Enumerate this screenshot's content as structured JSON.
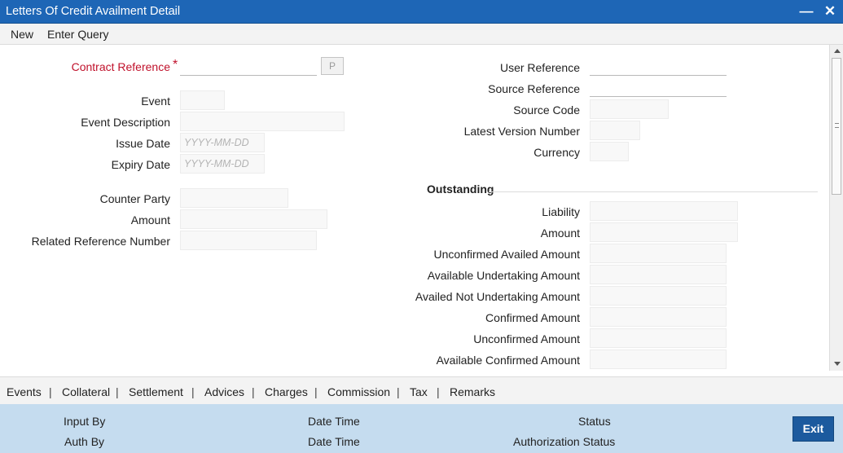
{
  "window": {
    "title": "Letters Of Credit Availment Detail",
    "minimize_glyph": "—",
    "close_glyph": "✕"
  },
  "menu": {
    "new": "New",
    "enter_query": "Enter Query"
  },
  "left": {
    "contract_reference": {
      "label": "Contract Reference",
      "required_mark": "*",
      "value": "",
      "pick_button": "P"
    },
    "event": {
      "label": "Event",
      "value": ""
    },
    "event_description": {
      "label": "Event Description",
      "value": ""
    },
    "issue_date": {
      "label": "Issue Date",
      "value": "",
      "placeholder": "YYYY-MM-DD"
    },
    "expiry_date": {
      "label": "Expiry Date",
      "value": "",
      "placeholder": "YYYY-MM-DD"
    },
    "counter_party": {
      "label": "Counter Party",
      "value": ""
    },
    "amount": {
      "label": "Amount",
      "value": ""
    },
    "related_reference_number": {
      "label": "Related Reference Number",
      "value": ""
    }
  },
  "right": {
    "user_reference": {
      "label": "User Reference",
      "value": ""
    },
    "source_reference": {
      "label": "Source Reference",
      "value": ""
    },
    "source_code": {
      "label": "Source Code",
      "value": ""
    },
    "latest_version_number": {
      "label": "Latest Version Number",
      "value": ""
    },
    "currency": {
      "label": "Currency",
      "value": ""
    }
  },
  "outstanding": {
    "title": "Outstanding",
    "liability": {
      "label": "Liability",
      "value": ""
    },
    "amount": {
      "label": "Amount",
      "value": ""
    },
    "unconfirmed_availed_amount": {
      "label": "Unconfirmed Availed Amount",
      "value": ""
    },
    "available_undertaking_amount": {
      "label": "Available Undertaking Amount",
      "value": ""
    },
    "availed_not_undertaking_amount": {
      "label": "Availed Not Undertaking Amount",
      "value": ""
    },
    "confirmed_amount": {
      "label": "Confirmed Amount",
      "value": ""
    },
    "unconfirmed_amount": {
      "label": "Unconfirmed Amount",
      "value": ""
    },
    "available_confirmed_amount": {
      "label": "Available Confirmed Amount",
      "value": ""
    }
  },
  "tabs": [
    "Events",
    "Collateral",
    "Settlement",
    "Advices",
    "Charges",
    "Commission",
    "Tax",
    "Remarks"
  ],
  "tab_separator": "|",
  "footer": {
    "input_by": "Input By",
    "date_time_1": "Date Time",
    "status": "Status",
    "auth_by": "Auth By",
    "date_time_2": "Date Time",
    "authorization_status": "Authorization Status",
    "exit_label": "Exit"
  },
  "colors": {
    "title_bar": "#1e66b6",
    "required": "#c0112b",
    "footer": "#c5dcef",
    "exit_button": "#1c5a9e"
  }
}
